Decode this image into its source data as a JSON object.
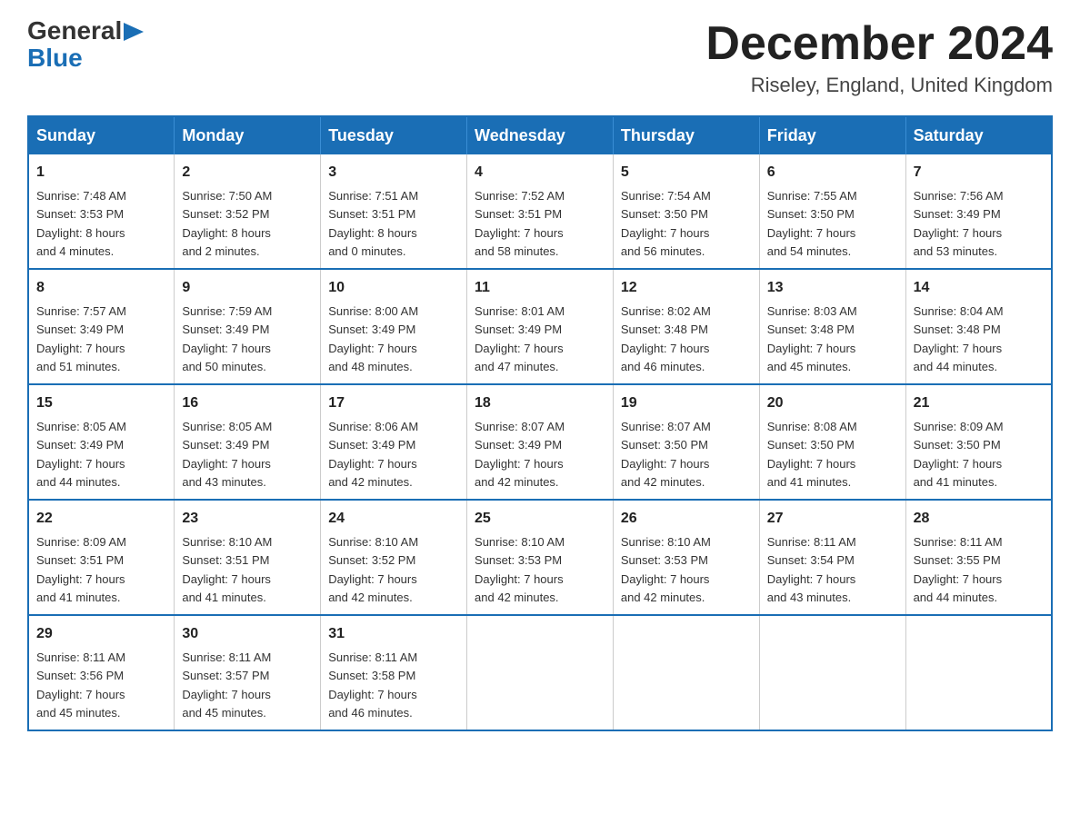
{
  "logo": {
    "line1": "General",
    "triangle": "▶",
    "line2": "Blue"
  },
  "title": "December 2024",
  "location": "Riseley, England, United Kingdom",
  "weekdays": [
    "Sunday",
    "Monday",
    "Tuesday",
    "Wednesday",
    "Thursday",
    "Friday",
    "Saturday"
  ],
  "weeks": [
    [
      {
        "day": "1",
        "sunrise": "Sunrise: 7:48 AM",
        "sunset": "Sunset: 3:53 PM",
        "daylight": "Daylight: 8 hours",
        "daylight2": "and 4 minutes."
      },
      {
        "day": "2",
        "sunrise": "Sunrise: 7:50 AM",
        "sunset": "Sunset: 3:52 PM",
        "daylight": "Daylight: 8 hours",
        "daylight2": "and 2 minutes."
      },
      {
        "day": "3",
        "sunrise": "Sunrise: 7:51 AM",
        "sunset": "Sunset: 3:51 PM",
        "daylight": "Daylight: 8 hours",
        "daylight2": "and 0 minutes."
      },
      {
        "day": "4",
        "sunrise": "Sunrise: 7:52 AM",
        "sunset": "Sunset: 3:51 PM",
        "daylight": "Daylight: 7 hours",
        "daylight2": "and 58 minutes."
      },
      {
        "day": "5",
        "sunrise": "Sunrise: 7:54 AM",
        "sunset": "Sunset: 3:50 PM",
        "daylight": "Daylight: 7 hours",
        "daylight2": "and 56 minutes."
      },
      {
        "day": "6",
        "sunrise": "Sunrise: 7:55 AM",
        "sunset": "Sunset: 3:50 PM",
        "daylight": "Daylight: 7 hours",
        "daylight2": "and 54 minutes."
      },
      {
        "day": "7",
        "sunrise": "Sunrise: 7:56 AM",
        "sunset": "Sunset: 3:49 PM",
        "daylight": "Daylight: 7 hours",
        "daylight2": "and 53 minutes."
      }
    ],
    [
      {
        "day": "8",
        "sunrise": "Sunrise: 7:57 AM",
        "sunset": "Sunset: 3:49 PM",
        "daylight": "Daylight: 7 hours",
        "daylight2": "and 51 minutes."
      },
      {
        "day": "9",
        "sunrise": "Sunrise: 7:59 AM",
        "sunset": "Sunset: 3:49 PM",
        "daylight": "Daylight: 7 hours",
        "daylight2": "and 50 minutes."
      },
      {
        "day": "10",
        "sunrise": "Sunrise: 8:00 AM",
        "sunset": "Sunset: 3:49 PM",
        "daylight": "Daylight: 7 hours",
        "daylight2": "and 48 minutes."
      },
      {
        "day": "11",
        "sunrise": "Sunrise: 8:01 AM",
        "sunset": "Sunset: 3:49 PM",
        "daylight": "Daylight: 7 hours",
        "daylight2": "and 47 minutes."
      },
      {
        "day": "12",
        "sunrise": "Sunrise: 8:02 AM",
        "sunset": "Sunset: 3:48 PM",
        "daylight": "Daylight: 7 hours",
        "daylight2": "and 46 minutes."
      },
      {
        "day": "13",
        "sunrise": "Sunrise: 8:03 AM",
        "sunset": "Sunset: 3:48 PM",
        "daylight": "Daylight: 7 hours",
        "daylight2": "and 45 minutes."
      },
      {
        "day": "14",
        "sunrise": "Sunrise: 8:04 AM",
        "sunset": "Sunset: 3:48 PM",
        "daylight": "Daylight: 7 hours",
        "daylight2": "and 44 minutes."
      }
    ],
    [
      {
        "day": "15",
        "sunrise": "Sunrise: 8:05 AM",
        "sunset": "Sunset: 3:49 PM",
        "daylight": "Daylight: 7 hours",
        "daylight2": "and 44 minutes."
      },
      {
        "day": "16",
        "sunrise": "Sunrise: 8:05 AM",
        "sunset": "Sunset: 3:49 PM",
        "daylight": "Daylight: 7 hours",
        "daylight2": "and 43 minutes."
      },
      {
        "day": "17",
        "sunrise": "Sunrise: 8:06 AM",
        "sunset": "Sunset: 3:49 PM",
        "daylight": "Daylight: 7 hours",
        "daylight2": "and 42 minutes."
      },
      {
        "day": "18",
        "sunrise": "Sunrise: 8:07 AM",
        "sunset": "Sunset: 3:49 PM",
        "daylight": "Daylight: 7 hours",
        "daylight2": "and 42 minutes."
      },
      {
        "day": "19",
        "sunrise": "Sunrise: 8:07 AM",
        "sunset": "Sunset: 3:50 PM",
        "daylight": "Daylight: 7 hours",
        "daylight2": "and 42 minutes."
      },
      {
        "day": "20",
        "sunrise": "Sunrise: 8:08 AM",
        "sunset": "Sunset: 3:50 PM",
        "daylight": "Daylight: 7 hours",
        "daylight2": "and 41 minutes."
      },
      {
        "day": "21",
        "sunrise": "Sunrise: 8:09 AM",
        "sunset": "Sunset: 3:50 PM",
        "daylight": "Daylight: 7 hours",
        "daylight2": "and 41 minutes."
      }
    ],
    [
      {
        "day": "22",
        "sunrise": "Sunrise: 8:09 AM",
        "sunset": "Sunset: 3:51 PM",
        "daylight": "Daylight: 7 hours",
        "daylight2": "and 41 minutes."
      },
      {
        "day": "23",
        "sunrise": "Sunrise: 8:10 AM",
        "sunset": "Sunset: 3:51 PM",
        "daylight": "Daylight: 7 hours",
        "daylight2": "and 41 minutes."
      },
      {
        "day": "24",
        "sunrise": "Sunrise: 8:10 AM",
        "sunset": "Sunset: 3:52 PM",
        "daylight": "Daylight: 7 hours",
        "daylight2": "and 42 minutes."
      },
      {
        "day": "25",
        "sunrise": "Sunrise: 8:10 AM",
        "sunset": "Sunset: 3:53 PM",
        "daylight": "Daylight: 7 hours",
        "daylight2": "and 42 minutes."
      },
      {
        "day": "26",
        "sunrise": "Sunrise: 8:10 AM",
        "sunset": "Sunset: 3:53 PM",
        "daylight": "Daylight: 7 hours",
        "daylight2": "and 42 minutes."
      },
      {
        "day": "27",
        "sunrise": "Sunrise: 8:11 AM",
        "sunset": "Sunset: 3:54 PM",
        "daylight": "Daylight: 7 hours",
        "daylight2": "and 43 minutes."
      },
      {
        "day": "28",
        "sunrise": "Sunrise: 8:11 AM",
        "sunset": "Sunset: 3:55 PM",
        "daylight": "Daylight: 7 hours",
        "daylight2": "and 44 minutes."
      }
    ],
    [
      {
        "day": "29",
        "sunrise": "Sunrise: 8:11 AM",
        "sunset": "Sunset: 3:56 PM",
        "daylight": "Daylight: 7 hours",
        "daylight2": "and 45 minutes."
      },
      {
        "day": "30",
        "sunrise": "Sunrise: 8:11 AM",
        "sunset": "Sunset: 3:57 PM",
        "daylight": "Daylight: 7 hours",
        "daylight2": "and 45 minutes."
      },
      {
        "day": "31",
        "sunrise": "Sunrise: 8:11 AM",
        "sunset": "Sunset: 3:58 PM",
        "daylight": "Daylight: 7 hours",
        "daylight2": "and 46 minutes."
      },
      null,
      null,
      null,
      null
    ]
  ]
}
